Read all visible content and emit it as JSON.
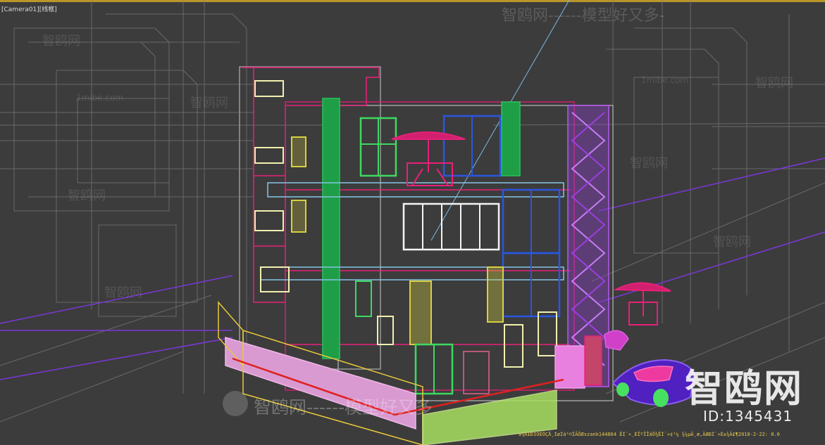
{
  "viewport": {
    "label_camera": "[Camera01]",
    "label_mode": "[线框]",
    "colors": {
      "background": "#3c3c3c",
      "border": "#b9962a",
      "wire_gray": "#8a8a8a",
      "magenta": "#e8207a",
      "green": "#26c35a",
      "yellow": "#d8d040",
      "blue": "#2a56e0",
      "purple": "#9a3ee0",
      "pink": "#e88ad8",
      "white": "#f0f0f0",
      "status_text": "#e6c84a"
    }
  },
  "watermarks": {
    "top": "智鸥网------模型好又多-",
    "bottom": "智鸥网------模型好又多",
    "repeated": "智鸥网",
    "site": "1mibe.com",
    "logo": "智鸥网",
    "id": "ID:1345431"
  },
  "status_bar": {
    "text": "±¾Ä£ÐÍÓÉÖÇÅ¸ÍøÌá¹©ÏÂÔØszank144864  ÊÌ¨«¸ÈÎºÎÎäÖ¾ÊÌ¨«¢¹¼ ¾¼µÄ¸æ,ÄÆÐÌ¨«È±¾Ä£¶2018-2-22: 0.0"
  },
  "scene": {
    "objects": [
      "building-wireframe",
      "patio-umbrella-top",
      "patio-umbrella-side",
      "car",
      "planter-wall",
      "vine-panel"
    ]
  }
}
